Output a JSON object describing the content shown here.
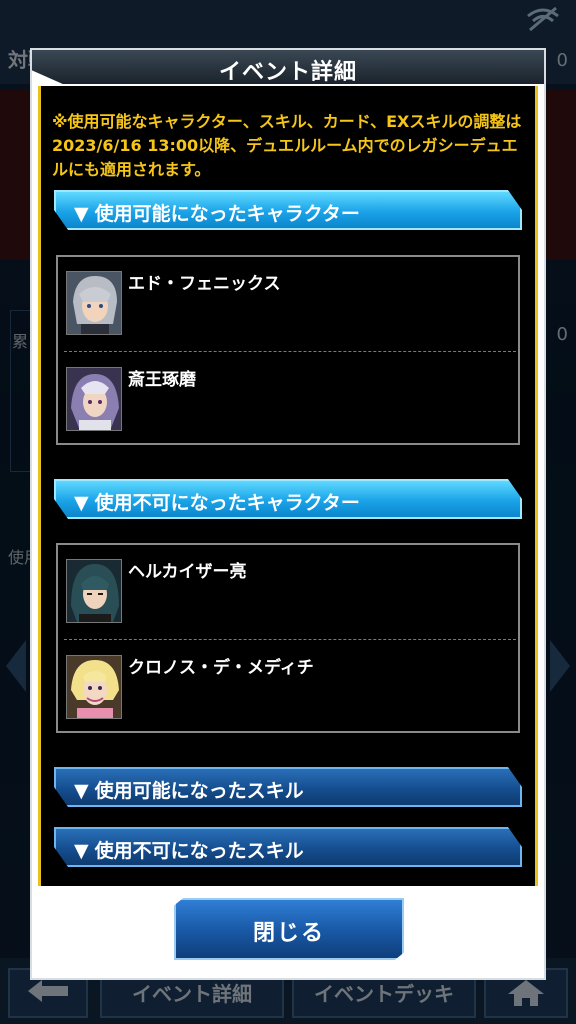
{
  "background": {
    "title": "対戦",
    "number_top": "0",
    "number_mid": "0",
    "label_left": "累",
    "label_left2": "使用",
    "bottom_buttons": [
      "",
      "イベント詳細",
      "イベントデッキ",
      ""
    ]
  },
  "dialog": {
    "title": "イベント詳細",
    "notice": "※使用可能なキャラクター、スキル、カード、EXスキルの調整は2023/6/16 13:00以降、デュエルルーム内でのレガシーデュエルにも適用されます。",
    "sections": [
      {
        "label": "使用可能になったキャラクター",
        "characters": [
          {
            "name": "エド・フェニックス",
            "portrait": "silver-hair-portrait"
          },
          {
            "name": "斎王琢磨",
            "portrait": "purple-hair-portrait"
          }
        ]
      },
      {
        "label": "使用不可になったキャラクター",
        "characters": [
          {
            "name": "ヘルカイザー亮",
            "portrait": "teal-hair-portrait"
          },
          {
            "name": "クロノス・デ・メディチ",
            "portrait": "blonde-hair-portrait"
          }
        ]
      },
      {
        "label": "使用可能になったスキル"
      },
      {
        "label": "使用不可になったスキル"
      }
    ],
    "close_label": "閉じる",
    "triangle": "▼"
  },
  "colors": {
    "notice": "#f5c518",
    "frame_gold": "#e8c21a",
    "section_active": "#1aa3e8",
    "section_inactive": "#154e8f"
  }
}
